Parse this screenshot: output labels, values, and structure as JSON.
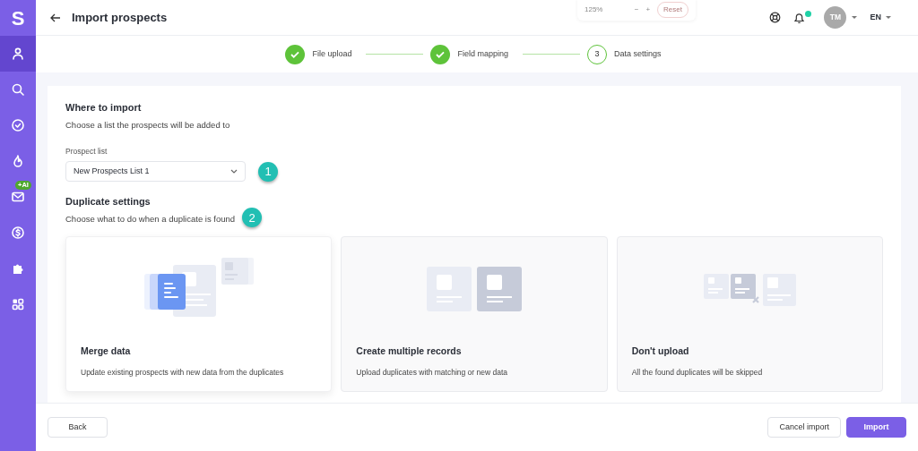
{
  "sidebar": {
    "logo": "S",
    "items": [
      {
        "selected": true
      },
      {
        "selected": false
      },
      {
        "selected": false
      },
      {
        "selected": false
      },
      {
        "selected": false,
        "badge": "+AI"
      },
      {
        "selected": false
      },
      {
        "selected": false
      },
      {
        "selected": false
      }
    ]
  },
  "header": {
    "title": "Import prospects",
    "zoom": {
      "value": "125%",
      "minus": "−",
      "plus": "+",
      "reset": "Reset"
    },
    "avatar": "TM",
    "notification": true,
    "language": "EN"
  },
  "steps": [
    {
      "label": "File upload",
      "completed": true
    },
    {
      "label": "Field mapping",
      "completed": true
    },
    {
      "number": "3",
      "label": "Data settings",
      "completed": false
    }
  ],
  "import_section": {
    "title": "Where to import",
    "subtitle": "Choose a list the prospects will be added to",
    "field_label": "Prospect list",
    "value": "New Prospects List 1",
    "marker": "1"
  },
  "duplicate_section": {
    "title": "Duplicate settings",
    "subtitle": "Choose what to do when a duplicate is found",
    "marker": "2",
    "options": [
      {
        "kind": "merge",
        "title": "Merge data",
        "description": "Update existing prospects with new data from the duplicates",
        "selected": true
      },
      {
        "kind": "multiple",
        "title": "Create multiple records",
        "description": "Upload duplicates with matching or new data",
        "selected": false
      },
      {
        "kind": "skip",
        "title": "Don't upload",
        "description": "All the found duplicates will be skipped",
        "selected": false
      }
    ]
  },
  "footer": {
    "back": "Back",
    "cancel": "Cancel import",
    "import": "Import"
  }
}
